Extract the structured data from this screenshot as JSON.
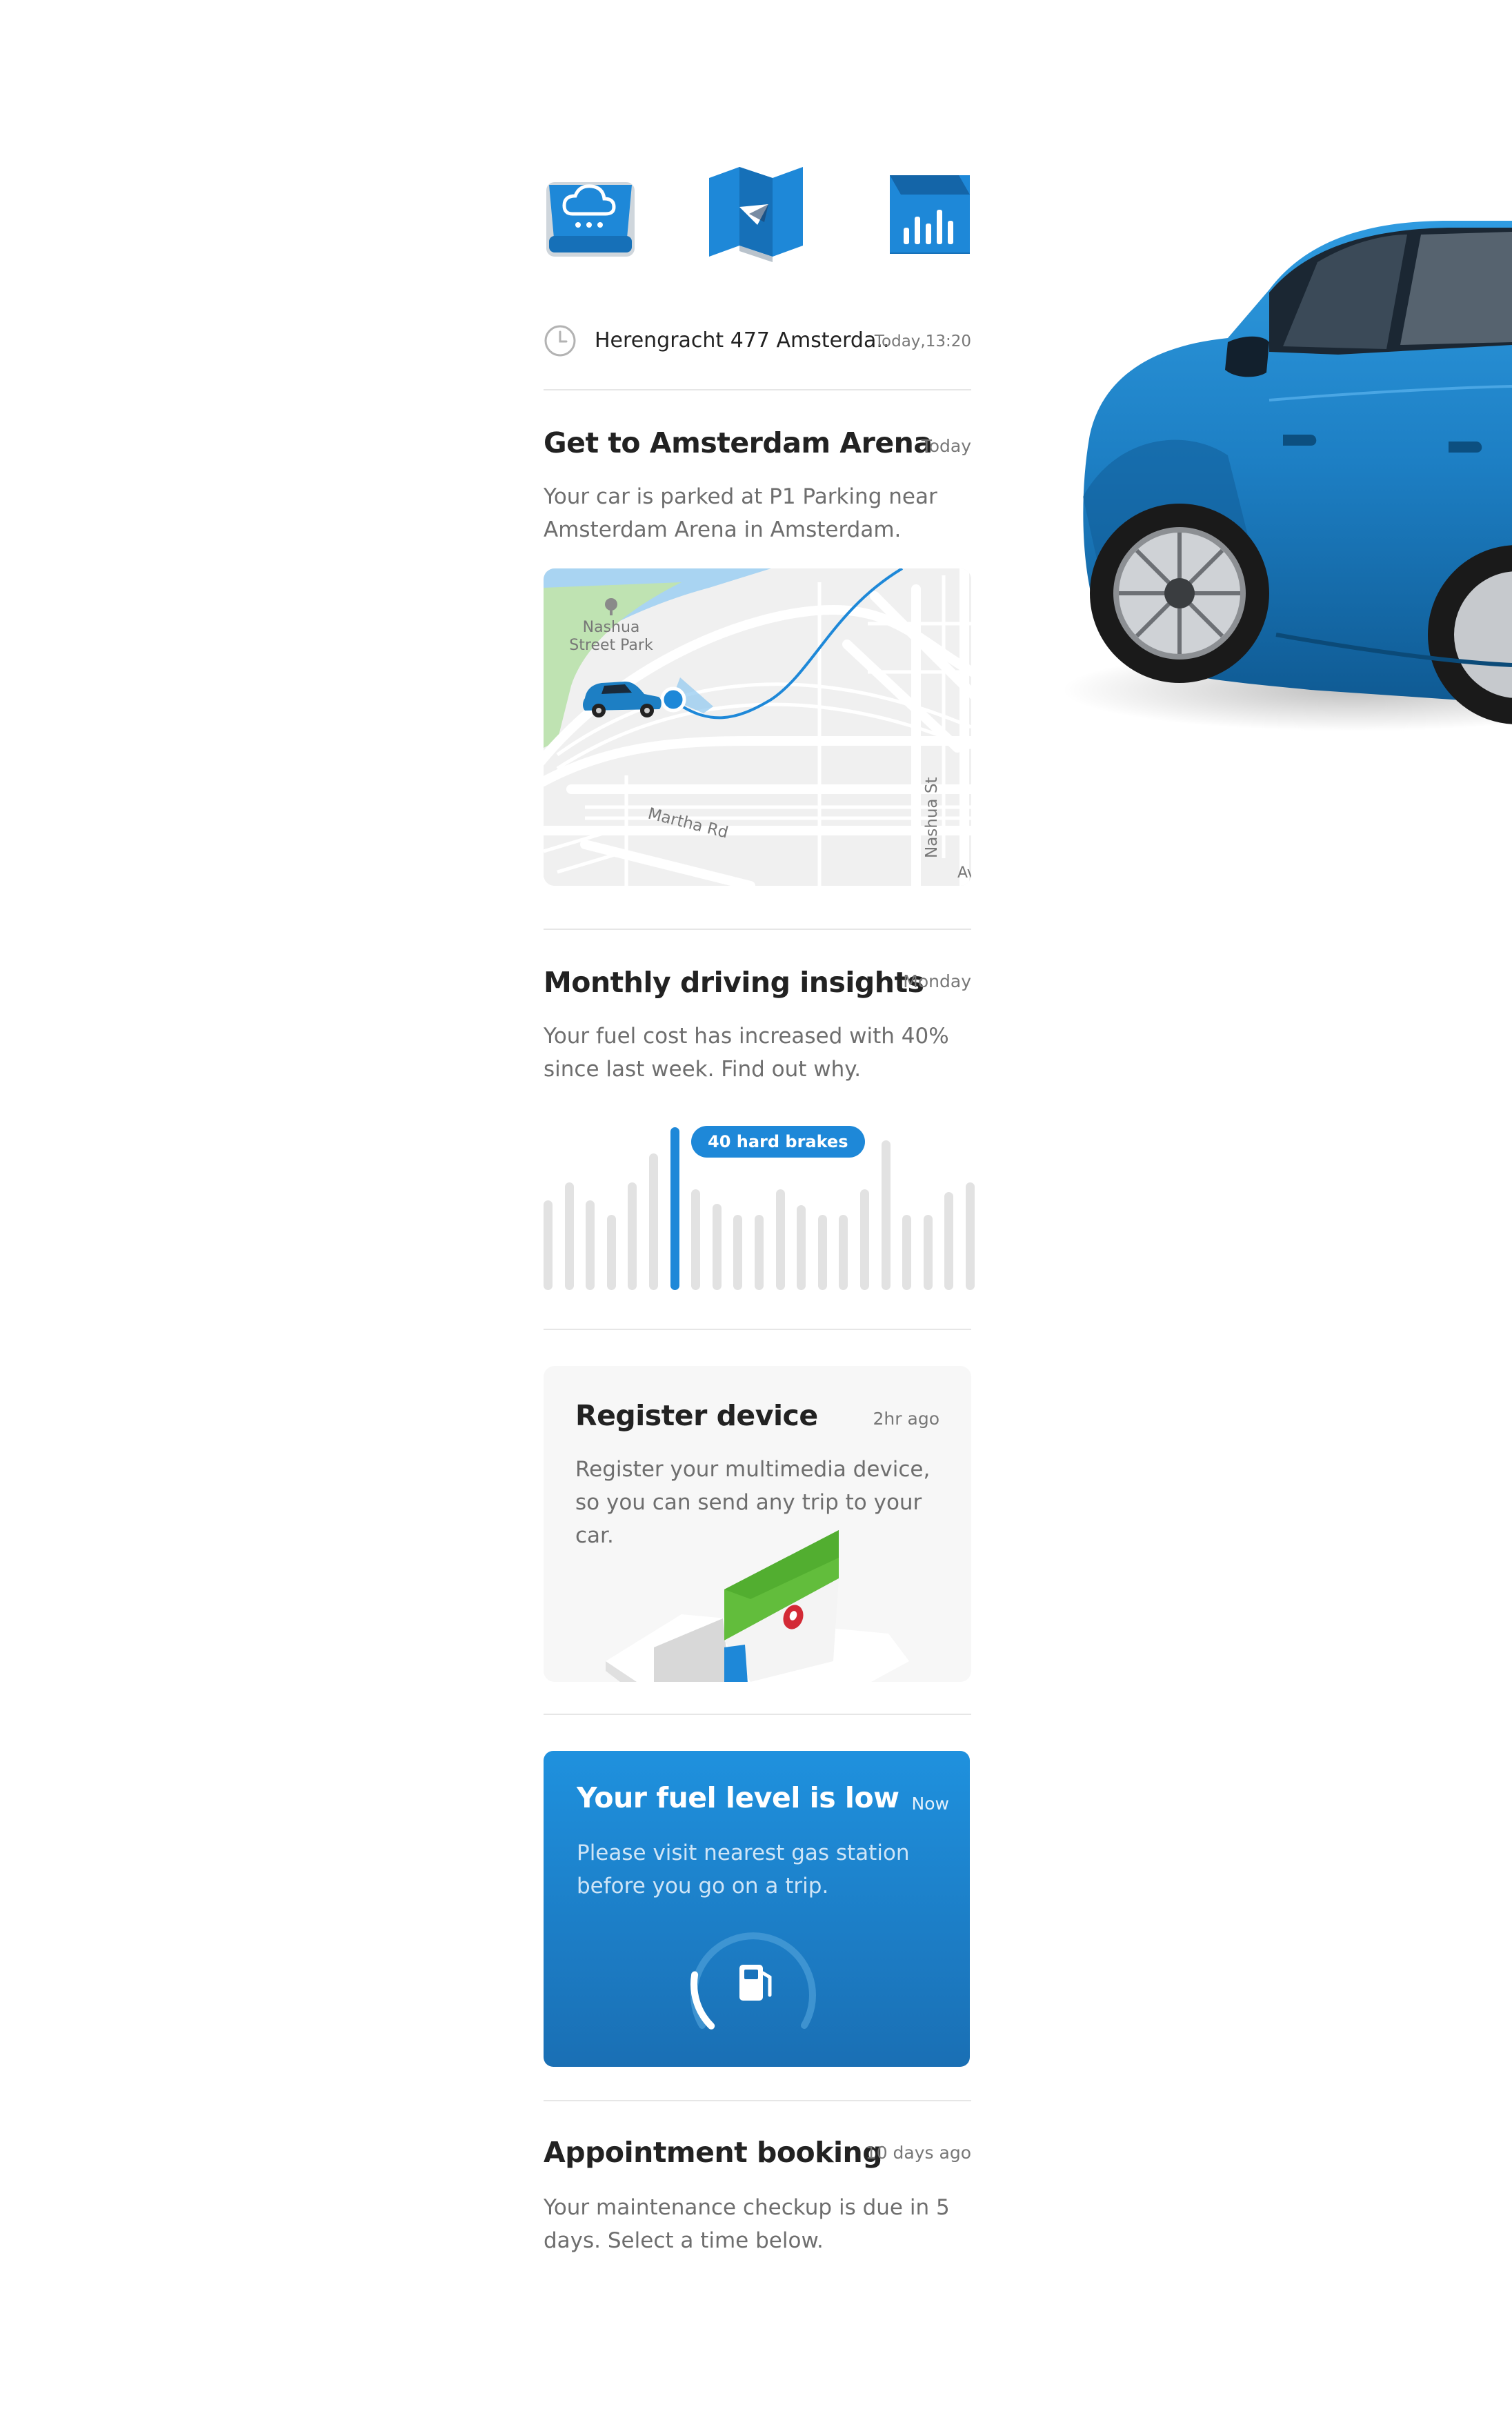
{
  "quick_actions": [
    {
      "name": "weather-cloud",
      "icon": "cloud-icon"
    },
    {
      "name": "map-navigation",
      "icon": "map-icon"
    },
    {
      "name": "driving-stats",
      "icon": "bar-chart-icon"
    }
  ],
  "recent_trip": {
    "address": "Herengracht 477 Amsterda..",
    "timestamp": "Today,13:20"
  },
  "parking_card": {
    "title": "Get to Amsterdam Arena",
    "time": "Today",
    "description": "Your car is parked at P1 Parking near Amsterdam Arena in Amsterdam.",
    "map": {
      "park_label_1": "Nashua",
      "park_label_2": "Street Park",
      "road_1": "Martha Rd",
      "road_2": "Nashua St",
      "road_3": "Av"
    }
  },
  "insights_card": {
    "title": "Monthly driving insights",
    "time": "Monday",
    "description": "Your fuel cost has increased with 40% since last week. Find out why.",
    "tooltip": "40 hard brakes",
    "highlight_index": 6,
    "bar_values": [
      0.55,
      0.66,
      0.55,
      0.46,
      0.66,
      0.84,
      1.0,
      0.62,
      0.53,
      0.46,
      0.46,
      0.62,
      0.52,
      0.46,
      0.46,
      0.62,
      0.92,
      0.46,
      0.46,
      0.6,
      0.66
    ]
  },
  "register_card": {
    "title": "Register device",
    "time": "2hr ago",
    "description": "Register your multimedia device, so you can send any trip to your car."
  },
  "fuel_card": {
    "title": "Your fuel level is low",
    "time": "Now",
    "description": "Please visit nearest gas station before you go on a trip.",
    "fuel_level": 0.2
  },
  "appointment_card": {
    "title": "Appointment booking",
    "time": "10 days ago",
    "description": "Your maintenance checkup is due in 5 days. Select a time below."
  },
  "colors": {
    "accent": "#1e88d8",
    "card_bg": "#f7f7f7",
    "text_primary": "#222222",
    "text_secondary": "#6e6e6e",
    "car_body": "#1d7fc4"
  }
}
